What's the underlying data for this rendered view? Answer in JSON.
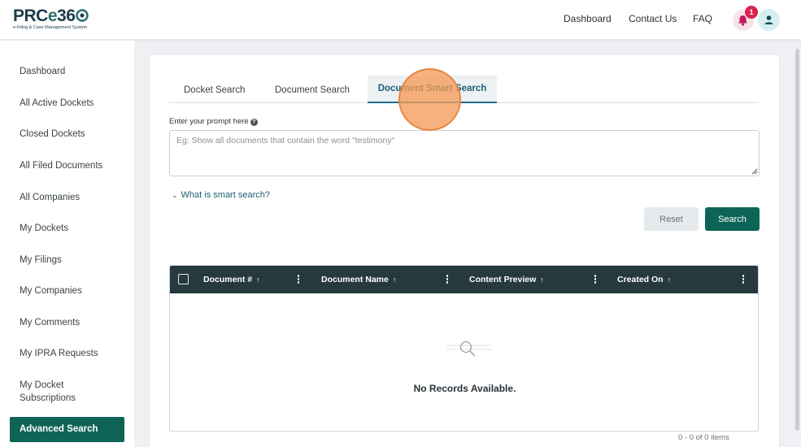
{
  "brand": {
    "name_prefix": "PRC",
    "name_e": "e",
    "name_suffix": "36",
    "tagline": "e-Filing & Case Management System"
  },
  "header": {
    "nav": [
      "Dashboard",
      "Contact Us",
      "FAQ"
    ],
    "notification_count": "1"
  },
  "sidebar": {
    "items": [
      "Dashboard",
      "All Active Dockets",
      "Closed Dockets",
      "All Filed Documents",
      "All Companies",
      "My Dockets",
      "My Filings",
      "My Companies",
      "My Comments",
      "My IPRA Requests",
      "My Docket Subscriptions"
    ],
    "active_item": "Advanced Search"
  },
  "search": {
    "tabs": [
      "Docket Search",
      "Document Search",
      "Document Smart Search"
    ],
    "active_tab_index": 2,
    "prompt_label": "Enter your prompt here",
    "prompt_placeholder": "Eg: Show all documents that contain the word \"testimony\"",
    "prompt_value": "",
    "smart_link": "What is smart search?",
    "reset_label": "Reset",
    "search_label": "Search"
  },
  "table": {
    "columns": [
      {
        "label": "Document #",
        "sort": "↑"
      },
      {
        "label": "Document Name",
        "sort": "↑"
      },
      {
        "label": "Content Preview",
        "sort": "↑"
      },
      {
        "label": "Created On",
        "sort": "↑"
      }
    ],
    "rows": [],
    "empty_message": "No Records Available.",
    "paging": "0 - 0 of 0 items"
  },
  "colors": {
    "primary": "#0f6458",
    "table_header": "#263a3e",
    "badge": "#d6244a",
    "click_indicator": "#f59b5a"
  }
}
